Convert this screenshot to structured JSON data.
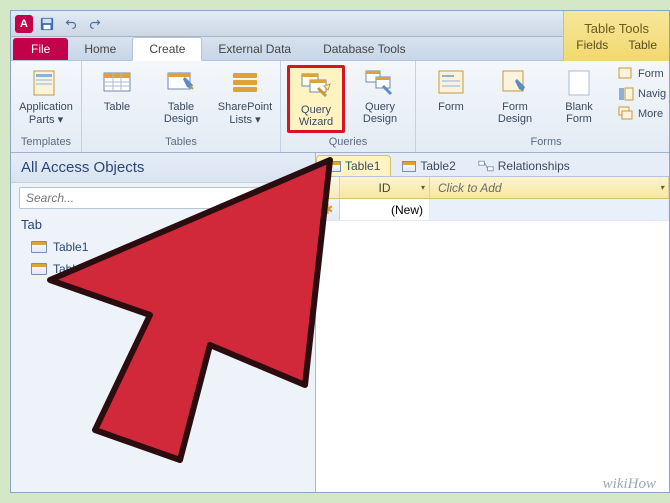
{
  "app": {
    "logo_letter": "A"
  },
  "tabs": {
    "file": "File",
    "home": "Home",
    "create": "Create",
    "external": "External Data",
    "database": "Database Tools"
  },
  "contextual": {
    "title": "Table Tools",
    "fields": "Fields",
    "table": "Table"
  },
  "ribbon": {
    "templates": {
      "label": "Templates",
      "app_parts": "Application Parts ▾"
    },
    "tables": {
      "label": "Tables",
      "table": "Table",
      "design": "Table Design",
      "sp": "SharePoint Lists ▾"
    },
    "queries": {
      "label": "Queries",
      "wizard": "Query Wizard",
      "design": "Query Design"
    },
    "forms": {
      "label": "Forms",
      "form": "Form",
      "design": "Form Design",
      "blank": "Blank Form",
      "wiz": "Form",
      "nav": "Navig",
      "more": "More"
    }
  },
  "nav": {
    "header": "All Access Objects",
    "search_placeholder": "Search...",
    "group": "Tab",
    "items": [
      "Table1",
      "Tabl"
    ]
  },
  "doctabs": {
    "t1": "Table1",
    "t2": "Table2",
    "rel": "Relationships"
  },
  "grid": {
    "id_col": "ID",
    "add_col": "Click to Add",
    "new_row": "(New)"
  },
  "watermark": "wikiHow"
}
